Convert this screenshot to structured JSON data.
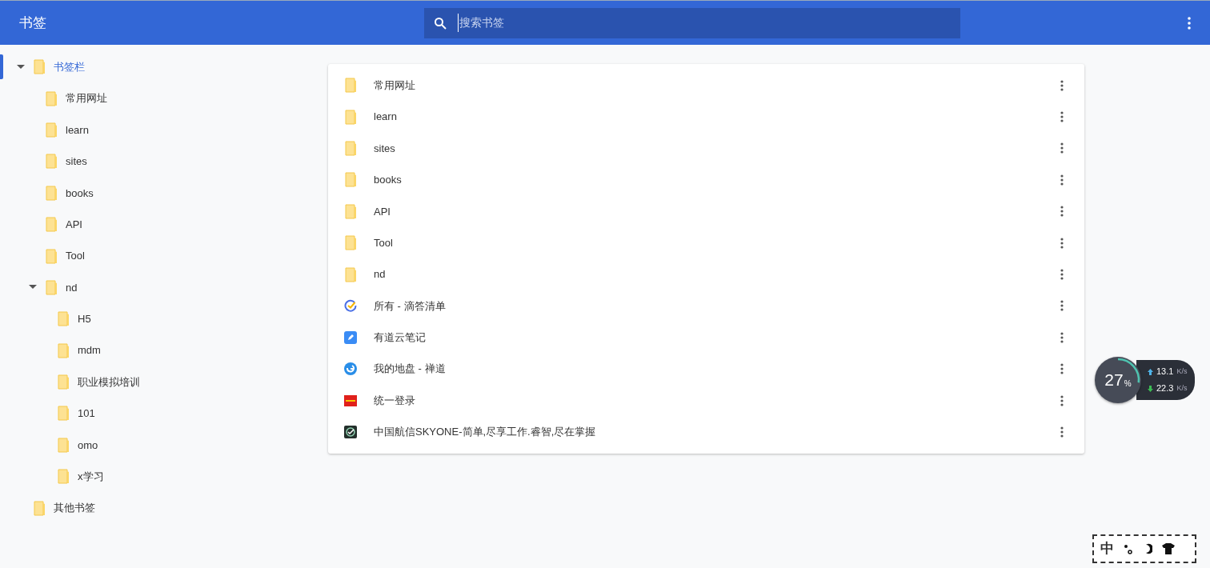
{
  "header": {
    "title": "书签",
    "search": {
      "placeholder": "搜索书签"
    }
  },
  "tree": [
    {
      "label": "书签栏",
      "selected": true,
      "expanded": true,
      "children": [
        {
          "label": "常用网址",
          "selected": false
        },
        {
          "label": "learn",
          "selected": false
        },
        {
          "label": "sites",
          "selected": false
        },
        {
          "label": "books",
          "selected": false
        },
        {
          "label": "API",
          "selected": false
        },
        {
          "label": "Tool",
          "selected": false
        },
        {
          "label": "nd",
          "selected": false,
          "expanded": true,
          "children": [
            {
              "label": "H5",
              "selected": false
            },
            {
              "label": "mdm",
              "selected": false
            },
            {
              "label": "职业模拟培训",
              "selected": false
            },
            {
              "label": "101",
              "selected": false
            },
            {
              "label": "omo",
              "selected": false
            },
            {
              "label": "x学习",
              "selected": false
            }
          ]
        }
      ]
    },
    {
      "label": "其他书签",
      "selected": false
    }
  ],
  "list": [
    {
      "kind": "folder",
      "title": "常用网址"
    },
    {
      "kind": "folder",
      "title": "learn"
    },
    {
      "kind": "folder",
      "title": "sites"
    },
    {
      "kind": "folder",
      "title": "books"
    },
    {
      "kind": "folder",
      "title": "API"
    },
    {
      "kind": "folder",
      "title": "Tool"
    },
    {
      "kind": "folder",
      "title": "nd"
    },
    {
      "kind": "check",
      "title": "所有 - 滴答清单"
    },
    {
      "kind": "note",
      "title": "有道云笔记"
    },
    {
      "kind": "swirl",
      "title": "我的地盘 - 禅道"
    },
    {
      "kind": "banner",
      "title": "统一登录"
    },
    {
      "kind": "gauge",
      "title": "中国航信SKYONE-简单,尽享工作.睿智,尽在掌握"
    }
  ],
  "speed_widget": {
    "percent": "27",
    "percent_unit": "%",
    "upload": "13.1",
    "upload_unit": "K/s",
    "download": "22.3",
    "download_unit": "K/s"
  },
  "ime_bar": {
    "mode": "中"
  }
}
